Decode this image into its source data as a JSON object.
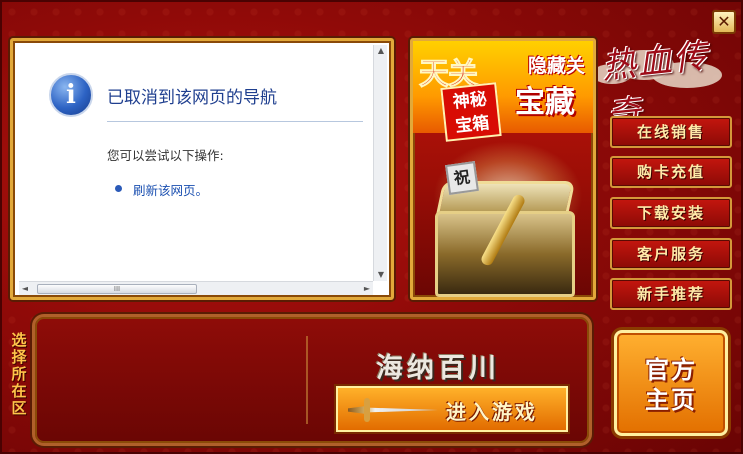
{
  "window": {
    "close_label": "✕",
    "logo_text": "热血传奇"
  },
  "browser": {
    "error_title": "已取消到该网页的导航",
    "subtitle": "您可以尝试以下操作:",
    "link": "刷新该网页。",
    "info_icon": "i",
    "scroll_thumb": "III",
    "scroll_left": "◄",
    "scroll_right": "►",
    "scroll_up": "▲",
    "scroll_down": "▼"
  },
  "promo": {
    "title_left": "天关",
    "title_right": "隐藏关",
    "title_big": "宝藏",
    "badge": "神秘宝箱",
    "dice_glyph": "祝"
  },
  "menu": {
    "items": [
      {
        "label": "在线销售"
      },
      {
        "label": "购卡充值"
      },
      {
        "label": "下载安装"
      },
      {
        "label": "客户服务"
      },
      {
        "label": "新手推荐"
      }
    ]
  },
  "server": {
    "region_label": "选择所在区",
    "server_name": "海纳百川",
    "enter_label": "进入游戏"
  },
  "official": {
    "label": "官方主页"
  },
  "colors": {
    "background_red": "#8f0a08",
    "gold": "#e2a93a",
    "button_orange": "#e26c00",
    "link_blue": "#1a4fb0"
  }
}
